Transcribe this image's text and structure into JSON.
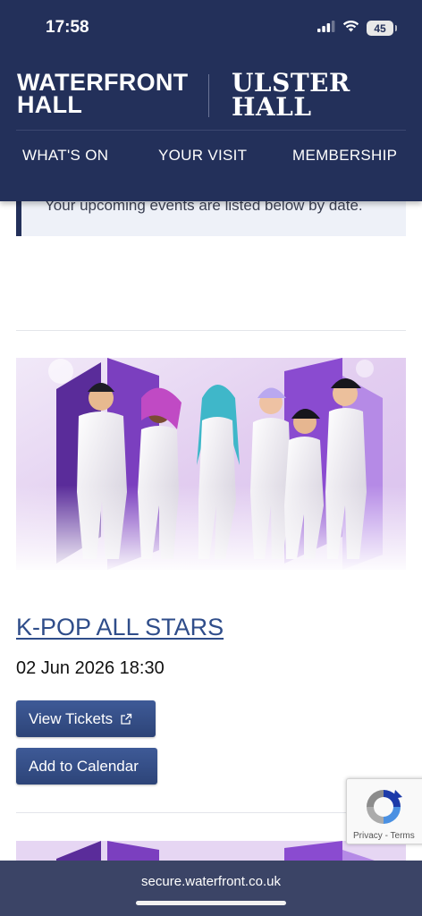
{
  "status_bar": {
    "time": "17:58",
    "battery": "45",
    "icons": [
      "cellular-signal-icon",
      "wifi-icon",
      "battery-icon"
    ]
  },
  "header": {
    "logo_left_line1": "WATERFRONT",
    "logo_left_line2": "HALL",
    "logo_right_line1": "ULSTER",
    "logo_right_line2": "HALL",
    "nav": [
      "WHAT'S ON",
      "YOUR VISIT",
      "MEMBERSHIP"
    ],
    "background": "#23305a"
  },
  "notice": {
    "text": "Your upcoming events are listed below by date."
  },
  "event": {
    "image": "k-pop-group-photo",
    "title": "K-POP ALL STARS",
    "datetime": "02 Jun 2026 18:30",
    "buttons": {
      "tickets": "View Tickets",
      "calendar": "Add to Calendar"
    },
    "button_icon": "external-link-icon",
    "accent": "#2f4d8a"
  },
  "recaptcha": {
    "privacy": "Privacy",
    "separator": " - ",
    "terms": "Terms"
  },
  "browser": {
    "url": "secure.waterfront.co.uk"
  }
}
